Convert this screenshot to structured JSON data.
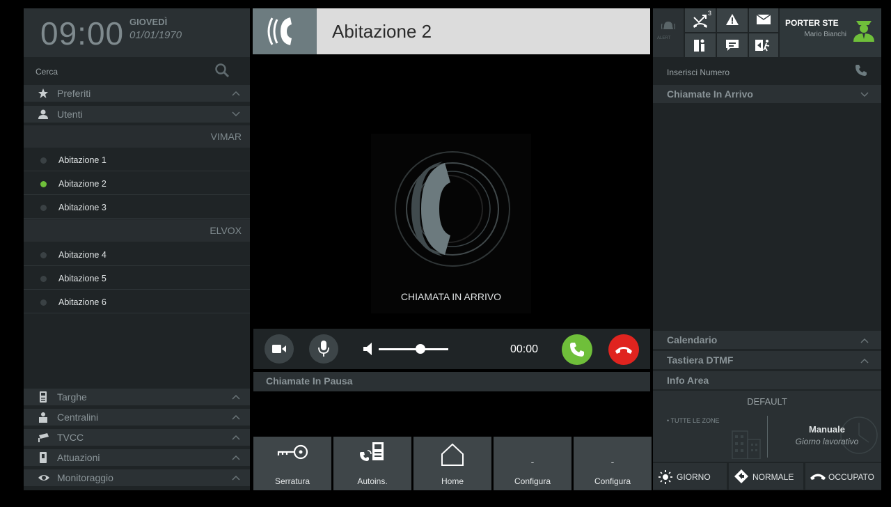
{
  "clock": {
    "time": "09:00",
    "day": "GIOVEDÌ",
    "date": "01/01/1970"
  },
  "search": {
    "label": "Cerca"
  },
  "sections": {
    "preferiti": "Preferiti",
    "utenti": "Utenti",
    "targhe": "Targhe",
    "centralini": "Centralini",
    "tvcc": "TVCC",
    "attuazioni": "Attuazioni",
    "monitoraggio": "Monitoraggio"
  },
  "groups": [
    {
      "name": "VIMAR",
      "items": [
        {
          "label": "Abitazione 1",
          "active": false
        },
        {
          "label": "Abitazione 2",
          "active": true
        },
        {
          "label": "Abitazione 3",
          "active": false
        }
      ]
    },
    {
      "name": "ELVOX",
      "items": [
        {
          "label": "Abitazione 4",
          "active": false
        },
        {
          "label": "Abitazione 5",
          "active": false
        },
        {
          "label": "Abitazione 6",
          "active": false
        }
      ]
    }
  ],
  "call": {
    "title": "Abitazione 2",
    "status": "CHIAMATA IN ARRIVO",
    "timer": "00:00",
    "volume": 0.6
  },
  "paused": {
    "label": "Chiamate In Pausa"
  },
  "buttons": [
    {
      "label": "Serratura",
      "icon": "key-icon"
    },
    {
      "label": "Autoins.",
      "icon": "autoinsertion-icon"
    },
    {
      "label": "Home",
      "icon": "home-icon"
    },
    {
      "label": "Configura",
      "icon": "dash"
    },
    {
      "label": "Configura",
      "icon": "dash"
    }
  ],
  "right": {
    "alert": "ALERT",
    "missed_count": "3",
    "porter": {
      "name": "PORTER STE",
      "user": "Mario Bianchi"
    },
    "number_placeholder": "Inserisci Numero",
    "incoming": "Chiamate In Arrivo",
    "calendar": "Calendario",
    "dtmf": "Tastiera DTMF",
    "info": "Info Area",
    "info_title": "DEFAULT",
    "zones": "• TUTTE LE ZONE",
    "mode": "Manuale",
    "day_type": "Giorno lavorativo",
    "modes": [
      "GIORNO",
      "NORMALE",
      "OCCUPATO"
    ]
  },
  "colors": {
    "accent": "#6fbf3a",
    "reject": "#e0241f",
    "active_dot": "#6fbf3a",
    "panel": "#1f2426"
  }
}
